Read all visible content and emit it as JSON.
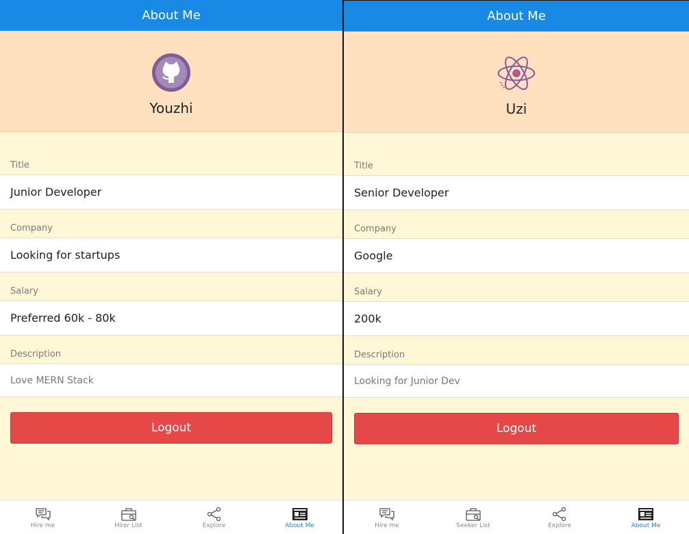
{
  "screens": [
    {
      "header_title": "About Me",
      "avatar_icon": "github-octocat-icon",
      "username": "Youzhi",
      "fields": {
        "title_label": "Title",
        "title_value": "Junior Developer",
        "company_label": "Company",
        "company_value": "Looking for startups",
        "salary_label": "Salary",
        "salary_value": "Preferred 60k - 80k",
        "description_label": "Description",
        "description_value": "Love MERN Stack"
      },
      "logout_label": "Logout",
      "tabs": [
        {
          "label": "Hire me",
          "icon": "chat-bubbles-icon",
          "active": false
        },
        {
          "label": "Hirer List",
          "icon": "briefcase-icon",
          "active": false
        },
        {
          "label": "Explore",
          "icon": "share-nodes-icon",
          "active": false
        },
        {
          "label": "About Me",
          "icon": "id-card-icon",
          "active": true
        }
      ]
    },
    {
      "header_title": "About Me",
      "avatar_icon": "react-atom-icon",
      "username": "Uzi",
      "fields": {
        "title_label": "Title",
        "title_value": "Senior Developer",
        "company_label": "Company",
        "company_value": "Google",
        "salary_label": "Salary",
        "salary_value": "200k",
        "description_label": "Description",
        "description_value": "Looking for Junior Dev"
      },
      "logout_label": "Logout",
      "tabs": [
        {
          "label": "Hire me",
          "icon": "chat-bubbles-icon",
          "active": false
        },
        {
          "label": "Seeker List",
          "icon": "briefcase-icon",
          "active": false
        },
        {
          "label": "Explore",
          "icon": "share-nodes-icon",
          "active": false
        },
        {
          "label": "About Me",
          "icon": "id-card-icon",
          "active": true
        }
      ]
    }
  ],
  "colors": {
    "header": "#1989e6",
    "profile_bg": "#ffe1bf",
    "page_bg": "#fff7d5",
    "logout": "#e64848",
    "active_tab": "#1989e6"
  }
}
